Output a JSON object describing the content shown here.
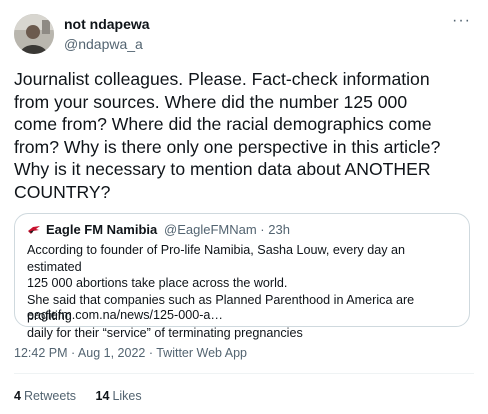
{
  "author": {
    "name": "not ndapewa",
    "handle": "@ndapwa_a"
  },
  "more_glyph": "···",
  "tweet_text": "Journalist colleagues. Please. Fact-check information\nfrom your sources. Where did the number 125 000\ncome from? Where did the racial demographics come\nfrom? Why is there only one perspective in this article?\nWhy is it necessary to mention data about ANOTHER\nCOUNTRY?",
  "quoted": {
    "name": "Eagle FM Namibia",
    "handle": "@EagleFMNam",
    "separator": "·",
    "time": "23h",
    "text": "According to founder of Pro-life Namibia, Sasha Louw, every day an estimated\n125 000 abortions take place across the world.\nShe said that companies such as Planned Parenthood in America are profiting\ndaily for their “service” of terminating pregnancies",
    "link": "eaglefm.com.na/news/125-000-a…",
    "logo_color": "#c8102e"
  },
  "timestamp": "12:42 PM · Aug 1, 2022 · Twitter Web App",
  "stats": {
    "retweets_count": "4",
    "retweets_label": "Retweets",
    "likes_count": "14",
    "likes_label": "Likes"
  }
}
